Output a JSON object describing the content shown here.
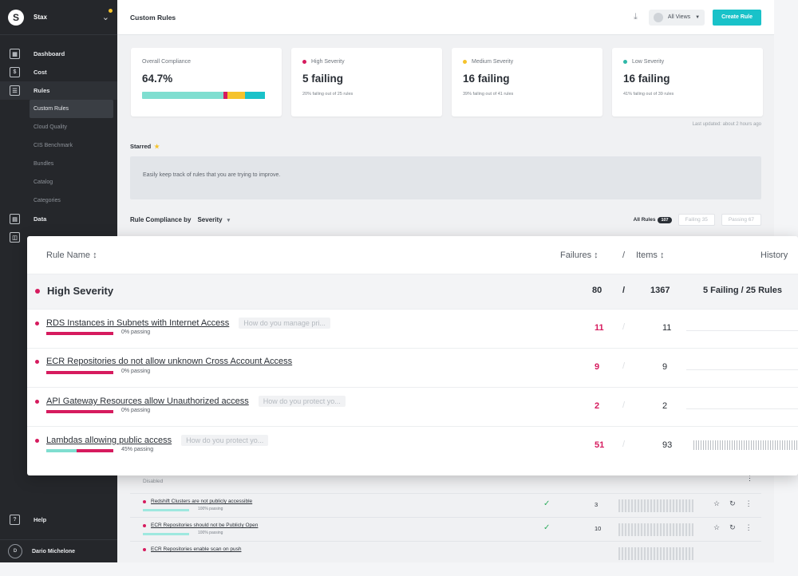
{
  "app": {
    "workspace": "Stax",
    "user": "Dario Michelone",
    "user_initial": "D"
  },
  "colors": {
    "accent": "#19c2c9",
    "high": "#d61b5e",
    "medium": "#f5c32c",
    "low": "#2fb8a8",
    "passing": "#7fded0"
  },
  "sidebar": {
    "items": [
      {
        "label": "Dashboard",
        "icon": "dashboard-icon"
      },
      {
        "label": "Cost",
        "icon": "cost-icon"
      },
      {
        "label": "Rules",
        "icon": "rules-icon"
      }
    ],
    "sub_items": [
      "Custom Rules",
      "Cloud Quality",
      "CIS Benchmark",
      "Bundles",
      "Catalog",
      "Categories"
    ],
    "data_label": "Data",
    "help": "Help"
  },
  "header": {
    "title": "Custom Rules",
    "views": "All Views",
    "create": "Create Rule"
  },
  "cards": {
    "overall": {
      "title": "Overall Compliance",
      "value": "64.7%",
      "bar": [
        0.64,
        0.03,
        0.14,
        0.16
      ]
    },
    "high": {
      "title": "High Severity",
      "value": "5 failing",
      "sub": "20% failing out of 25 rules"
    },
    "medium": {
      "title": "Medium Severity",
      "value": "16 failing",
      "sub": "39% failing out of 41 rules"
    },
    "low": {
      "title": "Low Severity",
      "value": "16 failing",
      "sub": "41% failing out of 39 rules"
    }
  },
  "updated": "Last updated: about 2 hours ago",
  "starred": {
    "label": "Starred",
    "text": "Easily keep track of rules that you are trying to improve."
  },
  "compliance": {
    "label": "Rule Compliance by",
    "group": "Severity",
    "filters": {
      "all": "All Rules",
      "all_count": "107",
      "failing": "Failing",
      "failing_count": "35",
      "passing": "Passing",
      "passing_count": "67"
    }
  },
  "table": {
    "headers": {
      "name": "Rule Name ↕",
      "failures": "Failures ↕",
      "slash": "/",
      "items": "Items ↕",
      "history": "History"
    },
    "severity": {
      "label": "High Severity",
      "failures": "80",
      "slash": "/",
      "items": "1367",
      "summary": "5 Failing / 25 Rules"
    },
    "rows": [
      {
        "name": "RDS Instances in Subnets with Internet Access",
        "question": "How do you manage pri...",
        "pct": "0% passing",
        "passing": 0,
        "failures": "11",
        "items": "11"
      },
      {
        "name": "ECR Repositories do not allow unknown Cross Account Access",
        "question": "",
        "pct": "0% passing",
        "passing": 0,
        "failures": "9",
        "items": "9"
      },
      {
        "name": "API Gateway Resources allow Unauthorized access",
        "question": "How do you protect yo...",
        "pct": "0% passing",
        "passing": 0,
        "failures": "2",
        "items": "2"
      },
      {
        "name": "Lambdas allowing public access",
        "question": "How do you protect yo...",
        "pct": "45% passing",
        "passing": 0.45,
        "failures": "51",
        "items": "93"
      }
    ]
  },
  "lower": {
    "disabled": "Disabled",
    "rows": [
      {
        "name": "Redshift Clusters are not publicly accessible",
        "pct": "100% passing",
        "items": "3"
      },
      {
        "name": "ECR Repositories should not be Publicly Open",
        "pct": "100% passing",
        "items": "10"
      },
      {
        "name": "ECR Repositories enable scan on push",
        "pct": "",
        "items": ""
      }
    ]
  }
}
